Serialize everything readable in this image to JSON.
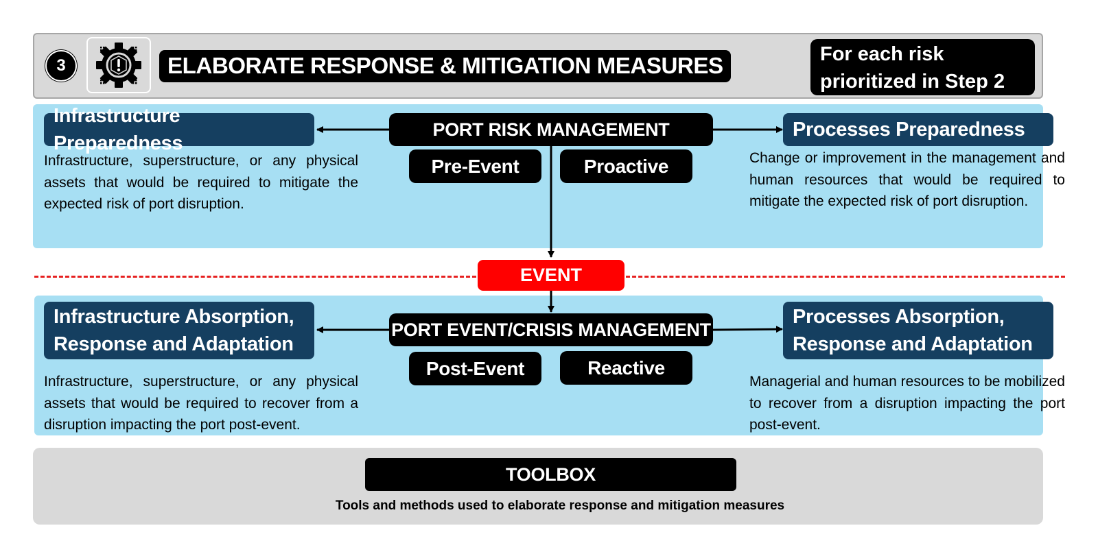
{
  "header": {
    "step_number": "3",
    "step_icon": "gear-warning-icon",
    "title": "ELABORATE RESPONSE & MITIGATION MEASURES",
    "scope_note_line1": "For each risk",
    "scope_note_line2": "prioritized in Step 2"
  },
  "pre_event": {
    "center_title": "PORT RISK MANAGEMENT",
    "tags": [
      "Pre-Event",
      "Proactive"
    ],
    "left": {
      "title": "Infrastructure Preparedness",
      "description": "Infrastructure, superstructure, or any physical assets that would be required to mitigate the expected risk of port disruption."
    },
    "right": {
      "title": "Processes Preparedness",
      "description": "Change or improvement in the management and human resources that would be required to mitigate the expected risk of port disruption."
    }
  },
  "event": {
    "label": "EVENT"
  },
  "post_event": {
    "center_title": "PORT EVENT/CRISIS MANAGEMENT",
    "tags": [
      "Post-Event",
      "Reactive"
    ],
    "left": {
      "title_line1": "Infrastructure Absorption,",
      "title_line2": "Response and Adaptation",
      "description": "Infrastructure, superstructure, or any physical assets that would be required to recover from a disruption impacting the port post-event."
    },
    "right": {
      "title_line1": "Processes Absorption,",
      "title_line2": "Response and Adaptation",
      "description": "Managerial and human resources to be mobilized to recover from a disruption impacting the port post-event."
    }
  },
  "toolbox": {
    "title": "TOOLBOX",
    "description": "Tools and methods used to elaborate response and mitigation measures"
  },
  "colors": {
    "panel_blue": "#a7dff3",
    "navy": "#153f60",
    "event_red": "#ff0000",
    "header_gray": "#d9d9d9"
  }
}
